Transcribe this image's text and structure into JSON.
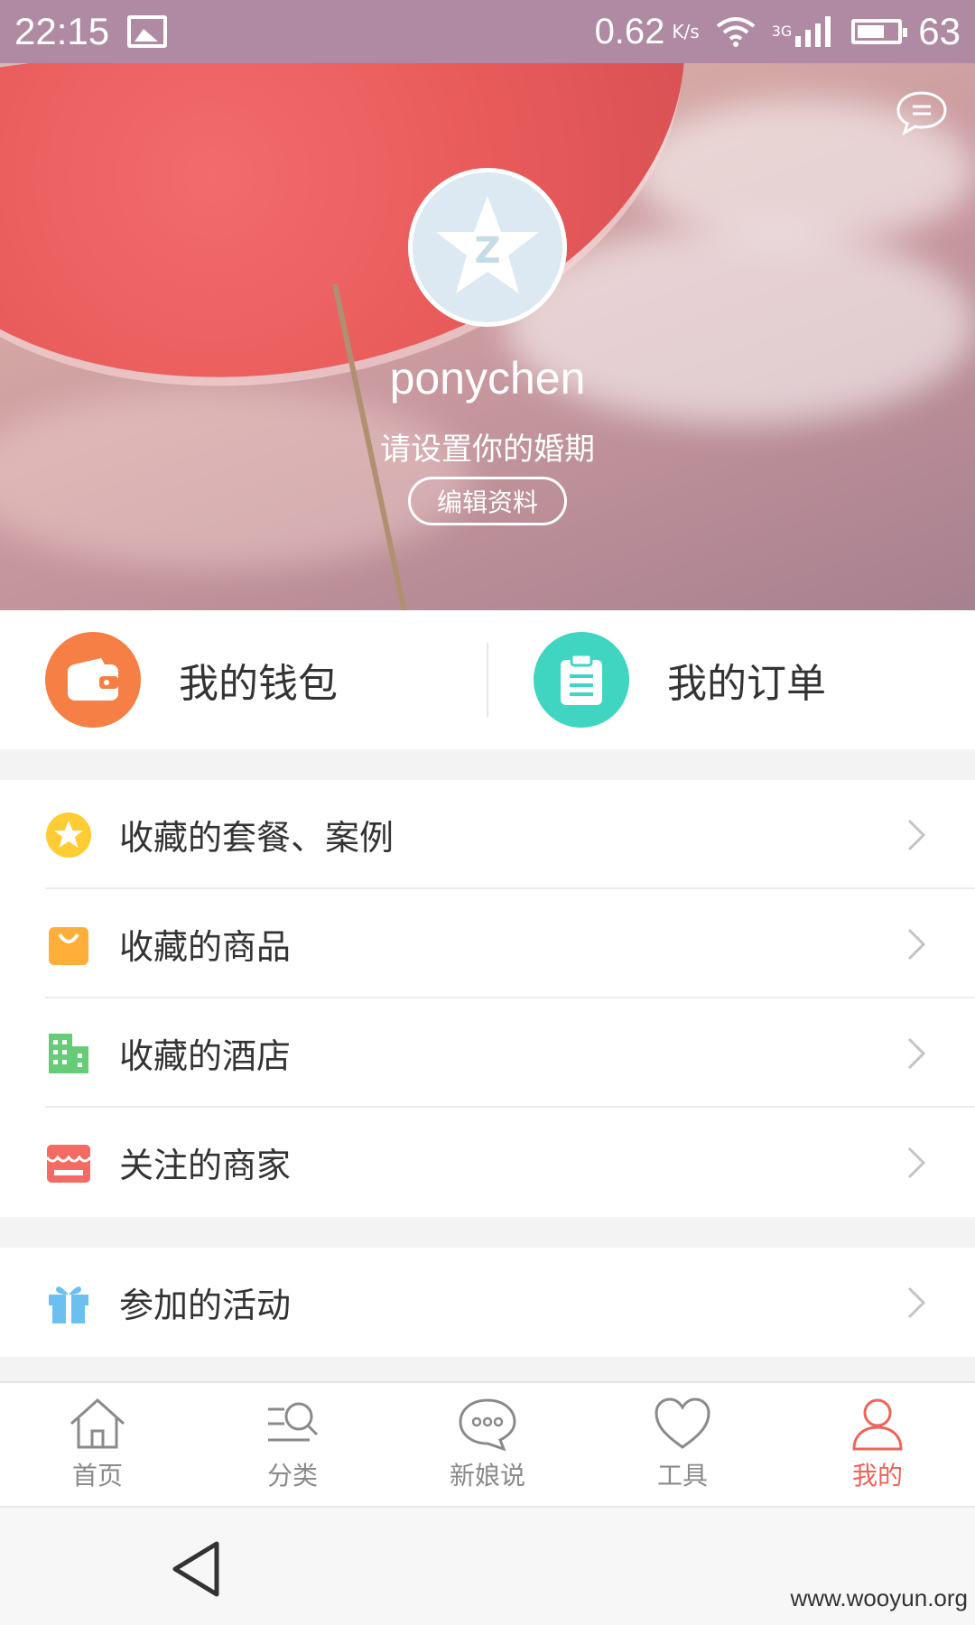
{
  "status_bar": {
    "time": "22:15",
    "net_speed": "0.62",
    "net_unit": "K/s",
    "network_type": "3G",
    "battery_level": "63"
  },
  "profile": {
    "username": "ponychen",
    "subtitle": "请设置你的婚期",
    "edit_button": "编辑资料"
  },
  "quick_actions": [
    {
      "label": "我的钱包",
      "icon": "wallet-icon",
      "color": "#f57f45"
    },
    {
      "label": "我的订单",
      "icon": "order-clipboard-icon",
      "color": "#3fd5c0"
    }
  ],
  "favorites": [
    {
      "label": "收藏的套餐、案例",
      "icon": "star-icon",
      "color": "#ffcc33"
    },
    {
      "label": "收藏的商品",
      "icon": "shopping-bag-icon",
      "color": "#ffae3a"
    },
    {
      "label": "收藏的酒店",
      "icon": "hotel-building-icon",
      "color": "#66cc77"
    },
    {
      "label": "关注的商家",
      "icon": "shop-icon",
      "color": "#f36b63"
    }
  ],
  "activities": [
    {
      "label": "参加的活动",
      "icon": "gift-icon",
      "color": "#6cc0f0"
    }
  ],
  "bottom_nav": [
    {
      "label": "首页",
      "icon": "home-icon",
      "active": false
    },
    {
      "label": "分类",
      "icon": "category-search-icon",
      "active": false
    },
    {
      "label": "新娘说",
      "icon": "chat-bubble-icon",
      "active": false
    },
    {
      "label": "工具",
      "icon": "heart-icon",
      "active": false
    },
    {
      "label": "我的",
      "icon": "user-icon",
      "active": true
    }
  ],
  "colors": {
    "active": "#f0635b",
    "inactive": "#8a8a8a",
    "status_bar": "#b08aa2"
  },
  "watermark": "www.wooyun.org"
}
